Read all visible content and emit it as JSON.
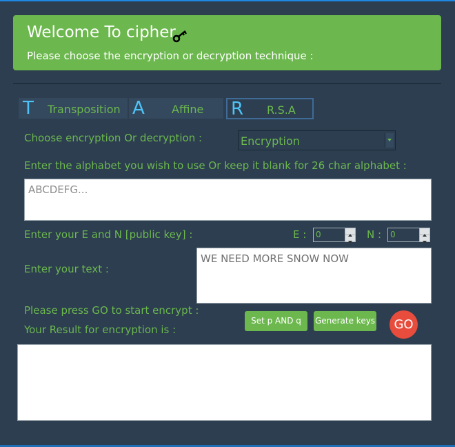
{
  "header": {
    "title": "Welcome To cipher",
    "subtitle": "Please choose the encryption or decryption technique :"
  },
  "tabs": [
    {
      "letter": "T",
      "label": "Transposition"
    },
    {
      "letter": "A",
      "label": "Affine"
    },
    {
      "letter": "R",
      "label": "R.S.A",
      "active": true
    }
  ],
  "form": {
    "mode_label": "Choose encryption Or decryption :",
    "mode_value": "Encryption",
    "alphabet_label": "Enter the alphabet you wish to use Or keep it blank for 26 char alphabet :",
    "alphabet_placeholder": "ABCDEFG...",
    "key_label": "Enter your E and N [public key] :",
    "e_label": "E :",
    "e_value": "0",
    "n_label": "N :",
    "n_value": "0",
    "text_label": "Enter your text :",
    "text_value": "WE NEED MORE SNOW NOW",
    "go_hint": "Please press GO to start encrypt :",
    "result_label": "Your Result for encryption is :",
    "result_value": ""
  },
  "buttons": {
    "set_pq": "Set p AND q",
    "generate": "Generate keys",
    "go": "GO"
  },
  "colors": {
    "background": "#2c3e50",
    "accent_green": "#6cb84e",
    "tab_letter": "#4fc3f7",
    "go_red": "#e74c3c"
  }
}
